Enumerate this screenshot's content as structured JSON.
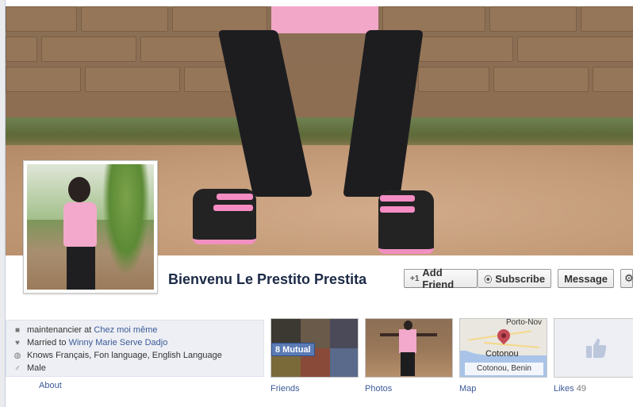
{
  "profile": {
    "name": "Bienvenu Le Prestito Prestita"
  },
  "actions": {
    "add_friend": "Add Friend",
    "subscribe": "Subscribe",
    "message": "Message"
  },
  "info": {
    "work_prefix": "maintenancier at",
    "work_place": "Chez moi même",
    "married_prefix": "Married to",
    "married_to": "Winny Marie Serve Dadjo",
    "languages": "Knows Français, Fon language, English Language",
    "gender": "Male",
    "about_link": "About"
  },
  "thumbnails": {
    "friends_label": "Friends",
    "mutual_badge": "8 Mutual",
    "photos_label": "Photos",
    "map_label": "Map",
    "map_city": "Cotonou",
    "map_city_top": "Porto-Nov",
    "map_caption": "Cotonou, Benin",
    "likes_label": "Likes",
    "likes_count": "49"
  },
  "colors": {
    "link": "#3b5998",
    "name": "#1c2a47",
    "info_bg": "#edeff4"
  },
  "icons": {
    "add_friend": "add-friend-icon",
    "subscribe": "rss-icon",
    "work": "briefcase-icon",
    "married": "heart-icon",
    "languages": "globe-icon",
    "gender": "male-icon"
  }
}
